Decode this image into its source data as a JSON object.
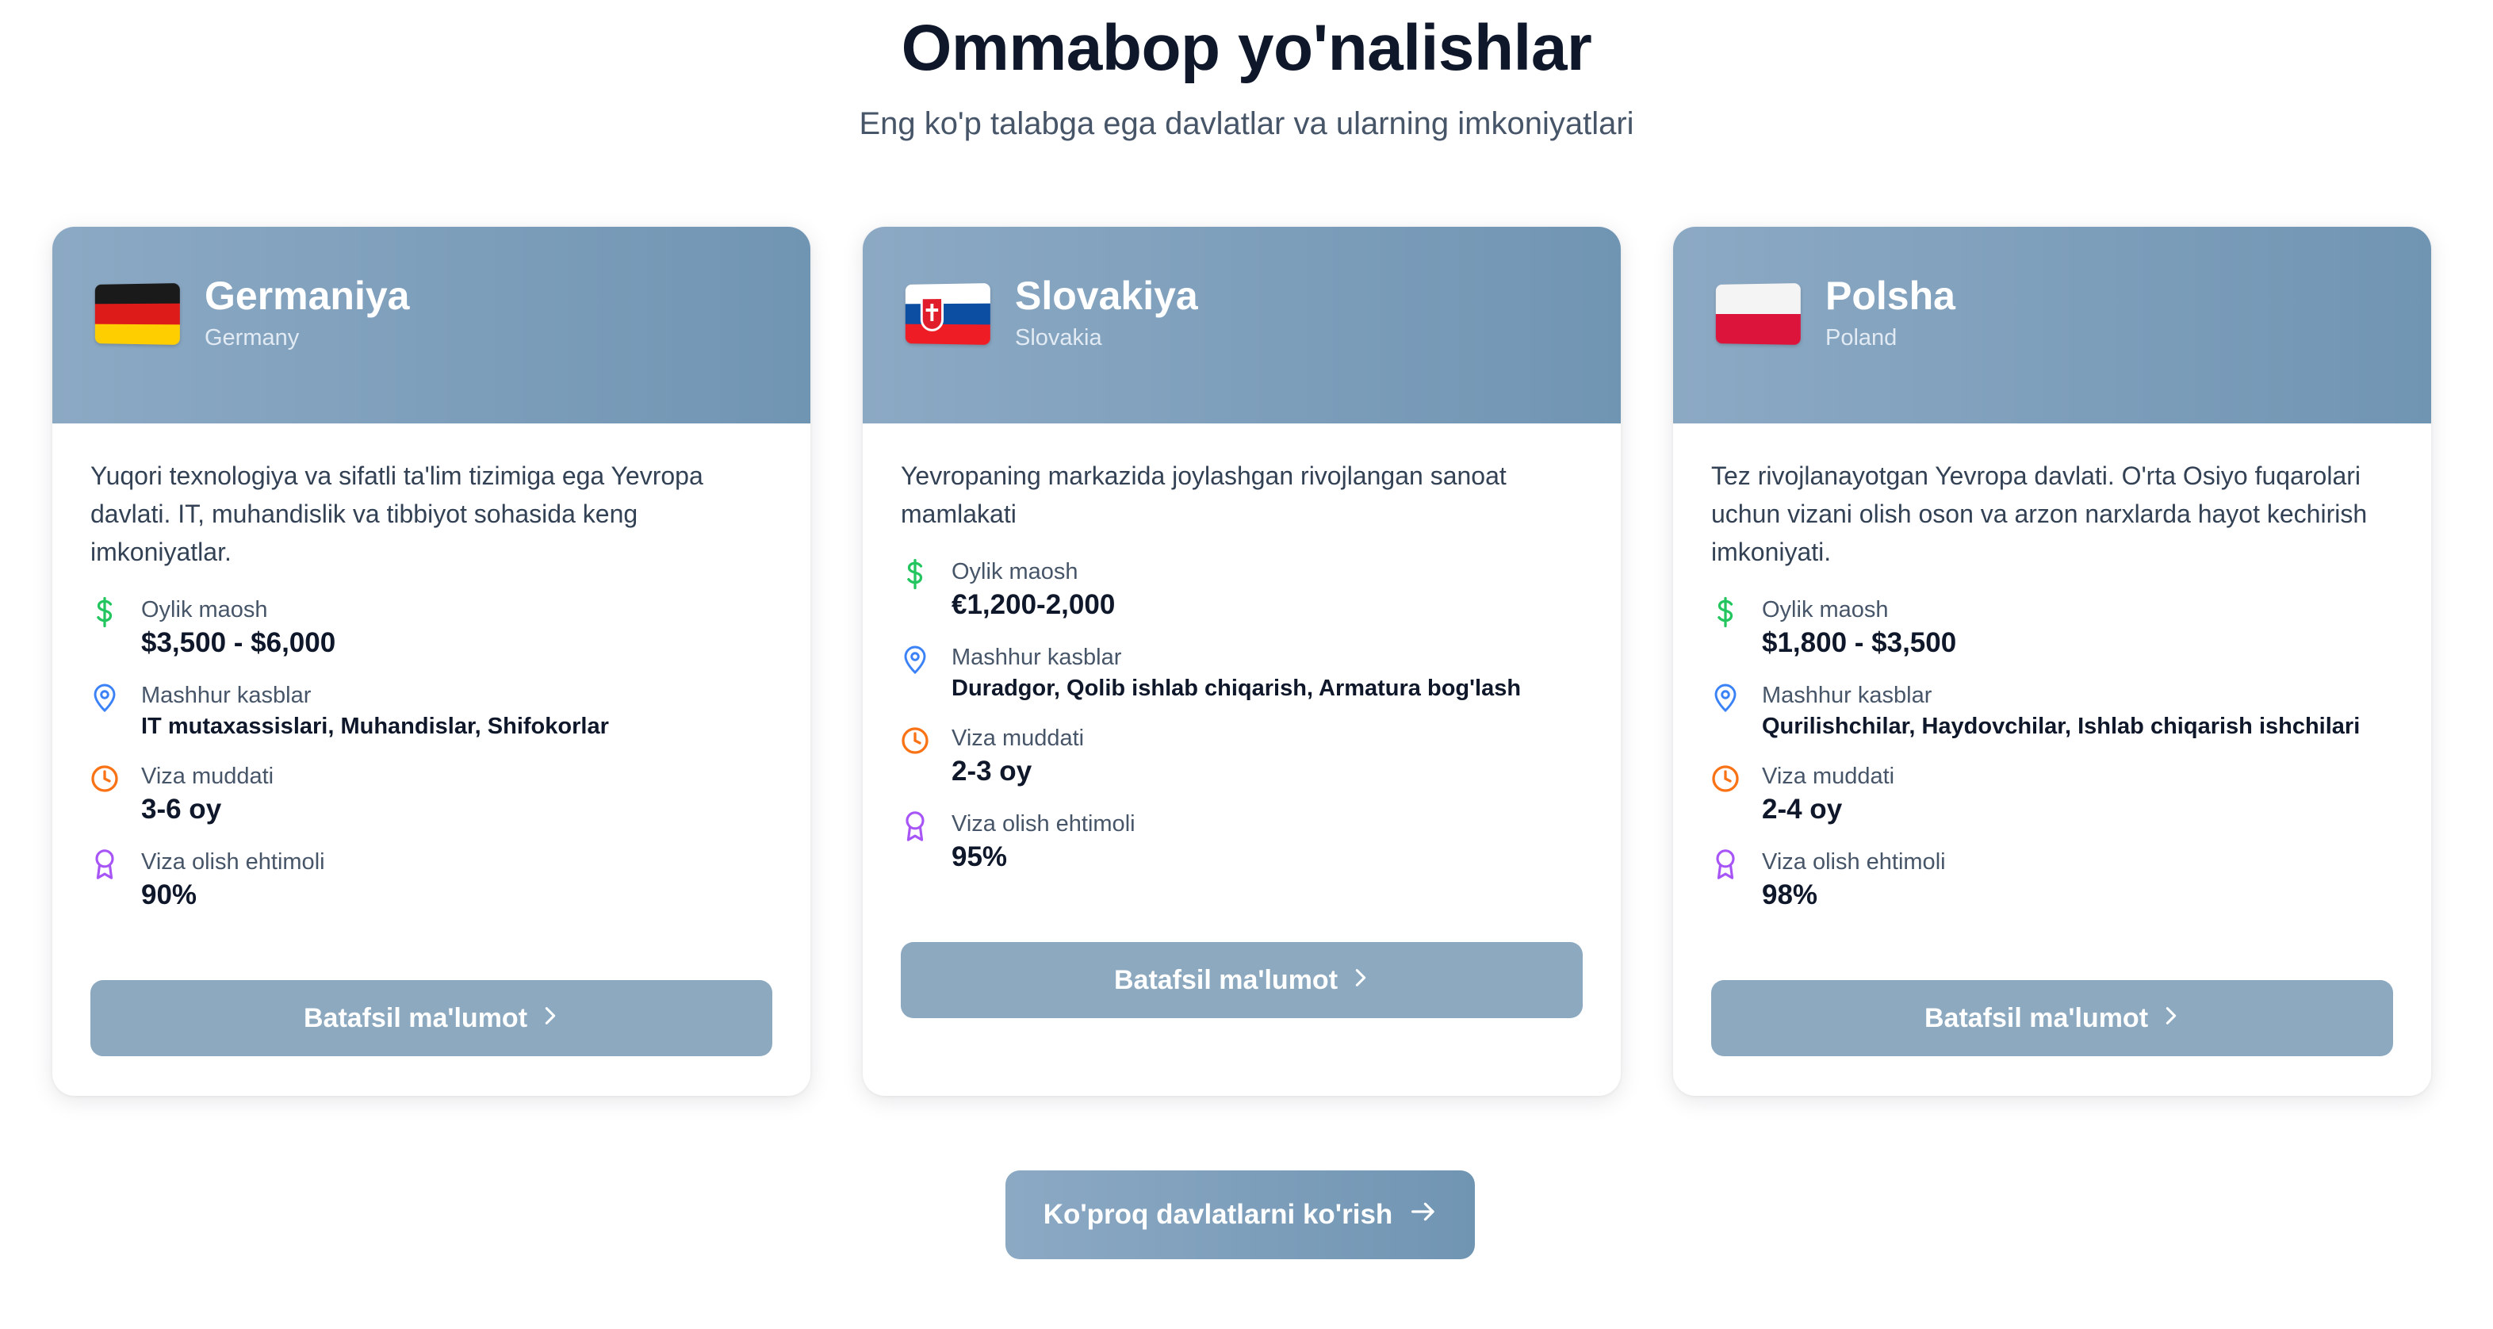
{
  "section": {
    "title": "Ommabop yo'nalishlar",
    "subtitle": "Eng ko'p talabga ega davlatlar va ularning imkoniyatlari"
  },
  "colors": {
    "header_gradient_start": "#8ca9c4",
    "header_gradient_end": "#7095b3",
    "button_bg": "#8ca9c0",
    "salary_icon": "#22c55e",
    "jobs_icon": "#3b82f6",
    "visa_time_icon": "#f97316",
    "visa_chance_icon": "#a855f7"
  },
  "labels": {
    "salary": "Oylik maosh",
    "jobs": "Mashhur kasblar",
    "visa_duration": "Viza muddati",
    "visa_probability": "Viza olish ehtimoli",
    "details_button": "Batafsil ma'lumot"
  },
  "icons": {
    "salary": "dollar-icon",
    "jobs": "map-pin-icon",
    "visa_duration": "clock-icon",
    "visa_probability": "award-icon",
    "details": "chevron-right-icon",
    "more": "arrow-right-icon"
  },
  "cards": [
    {
      "name": "Germaniya",
      "name_en": "Germany",
      "flag": "germany-flag-icon",
      "description": "Yuqori texnologiya va sifatli ta'lim tizimiga ega Yevropa davlati. IT, muhandislik va tibbiyot sohasida keng imkoniyatlar.",
      "salary": "$3,500 - $6,000",
      "jobs": "IT mutaxassislari, Muhandislar, Shifokorlar",
      "visa_duration": "3-6 oy",
      "visa_probability": "90%"
    },
    {
      "name": "Slovakiya",
      "name_en": "Slovakia",
      "flag": "slovakia-flag-icon",
      "description": "Yevropaning markazida joylashgan rivojlangan sanoat mamlakati",
      "salary": "€1,200-2,000",
      "jobs": "Duradgor, Qolib ishlab chiqarish, Armatura bog'lash",
      "visa_duration": "2-3 oy",
      "visa_probability": "95%"
    },
    {
      "name": "Polsha",
      "name_en": "Poland",
      "flag": "poland-flag-icon",
      "description": "Tez rivojlanayotgan Yevropa davlati. O'rta Osiyo fuqarolari uchun vizani olish oson va arzon narxlarda hayot kechirish imkoniyati.",
      "salary": "$1,800 - $3,500",
      "jobs": "Qurilishchilar, Haydovchilar, Ishlab chiqarish ishchilari",
      "visa_duration": "2-4 oy",
      "visa_probability": "98%"
    }
  ],
  "more_button": "Ko'proq davlatlarni ko'rish"
}
